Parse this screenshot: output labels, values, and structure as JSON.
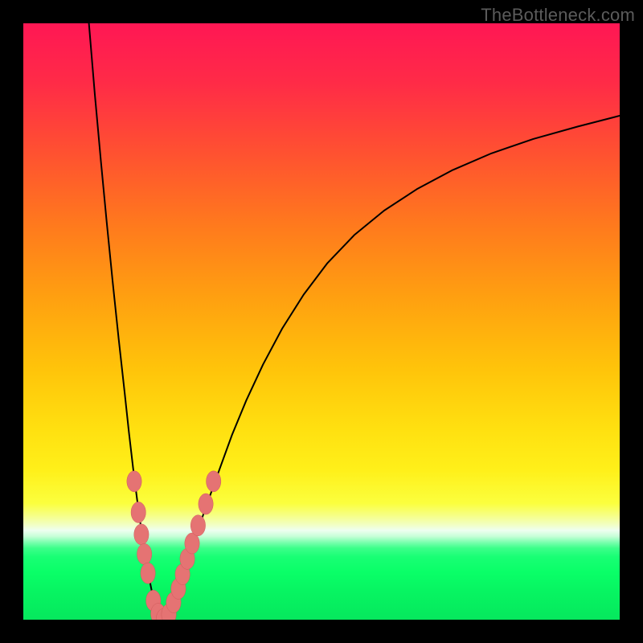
{
  "watermark": "TheBottleneck.com",
  "colors": {
    "curve": "#000000",
    "marker_fill": "#e57373",
    "marker_stroke": "#cf5b5b"
  },
  "chart_data": {
    "type": "line",
    "title": "",
    "xlabel": "",
    "ylabel": "",
    "xlim": [
      0,
      100
    ],
    "ylim": [
      0,
      100
    ],
    "series": [
      {
        "name": "left-branch",
        "x": [
          11.0,
          12.0,
          13.0,
          14.0,
          15.0,
          16.0,
          17.0,
          17.7,
          18.4,
          19.1,
          19.8,
          20.5,
          21.2,
          21.9
        ],
        "y": [
          100.0,
          88.0,
          77.0,
          66.5,
          56.5,
          47.0,
          38.0,
          31.5,
          25.5,
          20.0,
          15.0,
          10.5,
          6.5,
          3.0
        ]
      },
      {
        "name": "valley",
        "x": [
          21.9,
          22.3,
          22.7,
          23.1,
          23.5,
          23.9,
          24.3,
          24.7,
          25.1
        ],
        "y": [
          3.0,
          1.6,
          0.7,
          0.2,
          0.0,
          0.2,
          0.7,
          1.6,
          3.0
        ]
      },
      {
        "name": "right-branch",
        "x": [
          25.1,
          26.0,
          27.0,
          28.2,
          29.6,
          31.2,
          33.0,
          35.0,
          37.4,
          40.2,
          43.4,
          47.0,
          51.0,
          55.5,
          60.5,
          66.0,
          72.0,
          78.5,
          85.5,
          93.0,
          100.0
        ],
        "y": [
          3.0,
          5.5,
          8.5,
          12.0,
          16.0,
          20.5,
          25.5,
          31.0,
          36.8,
          42.8,
          48.8,
          54.5,
          59.8,
          64.5,
          68.6,
          72.2,
          75.4,
          78.2,
          80.6,
          82.7,
          84.5
        ]
      }
    ],
    "markers": [
      {
        "x": 18.6,
        "y": 23.2,
        "r": 1.3
      },
      {
        "x": 19.3,
        "y": 18.0,
        "r": 1.3
      },
      {
        "x": 19.8,
        "y": 14.3,
        "r": 1.3
      },
      {
        "x": 20.3,
        "y": 11.0,
        "r": 1.3
      },
      {
        "x": 20.9,
        "y": 7.8,
        "r": 1.3
      },
      {
        "x": 21.8,
        "y": 3.2,
        "r": 1.3
      },
      {
        "x": 22.6,
        "y": 1.0,
        "r": 1.3
      },
      {
        "x": 23.5,
        "y": 0.1,
        "r": 1.3
      },
      {
        "x": 24.4,
        "y": 0.9,
        "r": 1.3
      },
      {
        "x": 25.2,
        "y": 2.9,
        "r": 1.3
      },
      {
        "x": 26.0,
        "y": 5.2,
        "r": 1.3
      },
      {
        "x": 26.7,
        "y": 7.6,
        "r": 1.3
      },
      {
        "x": 27.5,
        "y": 10.2,
        "r": 1.3
      },
      {
        "x": 28.3,
        "y": 12.8,
        "r": 1.3
      },
      {
        "x": 29.3,
        "y": 15.8,
        "r": 1.3
      },
      {
        "x": 30.6,
        "y": 19.4,
        "r": 1.3
      },
      {
        "x": 31.9,
        "y": 23.2,
        "r": 1.3
      }
    ]
  }
}
